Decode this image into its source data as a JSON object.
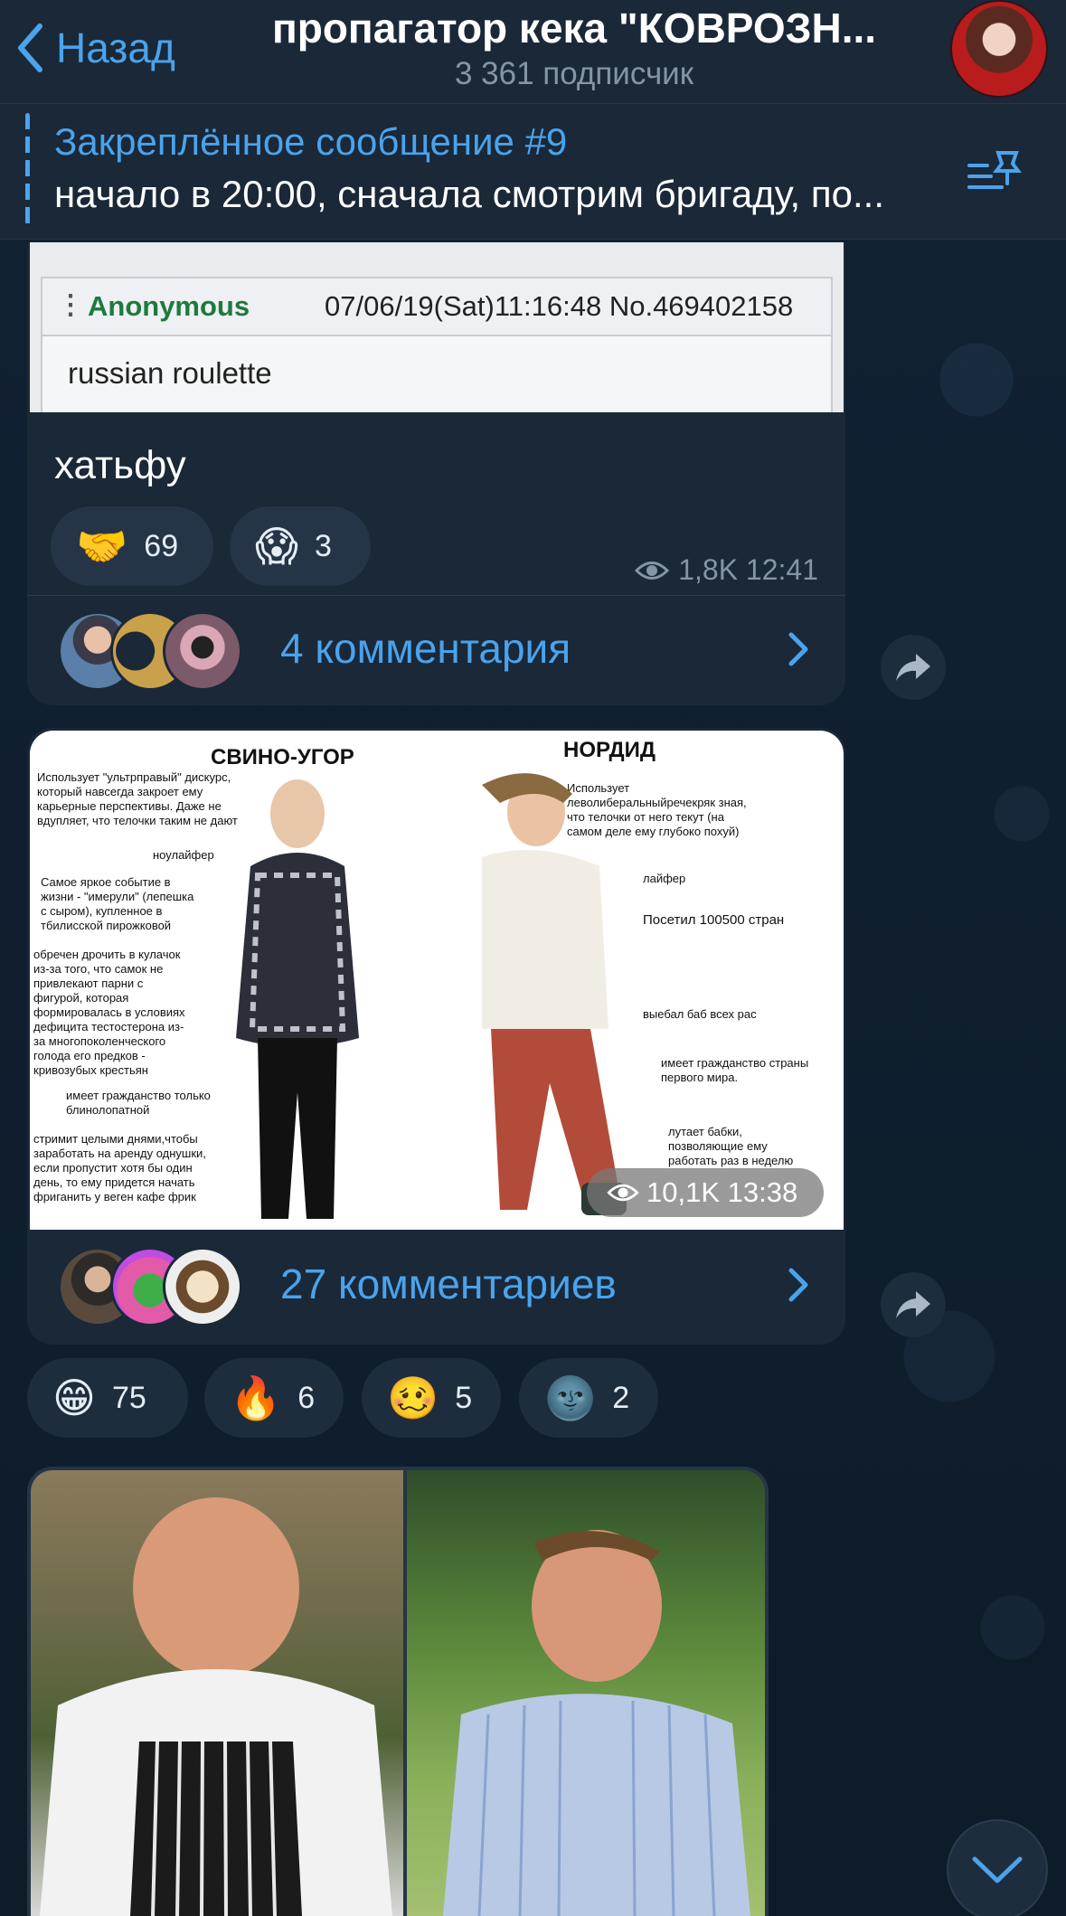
{
  "header": {
    "back_label": "Назад",
    "title": "пропагатор кека \"КОВРОЗН...",
    "subtitle": "3 361 подписчик"
  },
  "pinned": {
    "title": "Закреплённое сообщение #9",
    "text": "начало в 20:00, сначала смотрим бригаду, по..."
  },
  "messages": [
    {
      "screenshot": {
        "name": "Anonymous",
        "date": "07/06/19(Sat)11:16:48 No.469402158",
        "text": "russian roulette"
      },
      "caption": "хатьфу",
      "reactions": [
        {
          "emoji": "🤝",
          "count": "69"
        },
        {
          "emoji": "😱",
          "count": "3"
        }
      ],
      "views": "1,8K",
      "time": "12:41",
      "comments": "4 комментария"
    },
    {
      "meme": {
        "left_title": "СВИНО-УГОР",
        "right_title": "НОРДИД",
        "left_notes": [
          "Использует \"ультрправый\" дискурс, который навсегда закроет ему карьерные перспективы. Даже не вдупляет, что телочки таким не дают",
          "ноулайфер",
          "Самое яркое событие в жизни - \"имерули\" (лепешка с сыром), купленное в тбилисской пирожковой",
          "обречен дрочить в кулачок из-за того, что самок не привлекают парни с фигурой, которая формировалась в условиях дефицита тестостерона из-за многопоколенческого голода его предков - кривозубых крестьян",
          "имеет гражданство только блинолопатной",
          "стримит целыми днями,чтобы заработать на аренду однушки, если пропустит хотя бы один день, то ему придется начать фриганить у веген кафе фрик"
        ],
        "right_notes": [
          "Использует леволиберальныйречекряк зная, что телочки от него текут (на самом деле ему глубоко похуй)",
          "лайфер",
          "Посетил 100500 стран",
          "выебал баб всех рас",
          "имеет гражданство страны первого мира.",
          "лутает бабки, позволяющие ему работать раз в неделю"
        ]
      },
      "views": "10,1K",
      "time": "13:38",
      "comments": "27 комментариев",
      "reactions": [
        {
          "emoji": "😁",
          "count": "75"
        },
        {
          "emoji": "🔥",
          "count": "6"
        },
        {
          "emoji": "🥴",
          "count": "5"
        },
        {
          "emoji": "🌚",
          "count": "2"
        }
      ]
    }
  ],
  "icons": {
    "back": "chevron-left-icon",
    "pinned_list": "pinned-list-icon",
    "eye": "eye-icon",
    "share": "share-icon",
    "chevron": "chevron-right-icon",
    "scroll_down": "chevron-down-icon"
  },
  "colors": {
    "accent": "#4aa3ec",
    "bubble": "#1a2838",
    "background": "#0f1c2b"
  }
}
